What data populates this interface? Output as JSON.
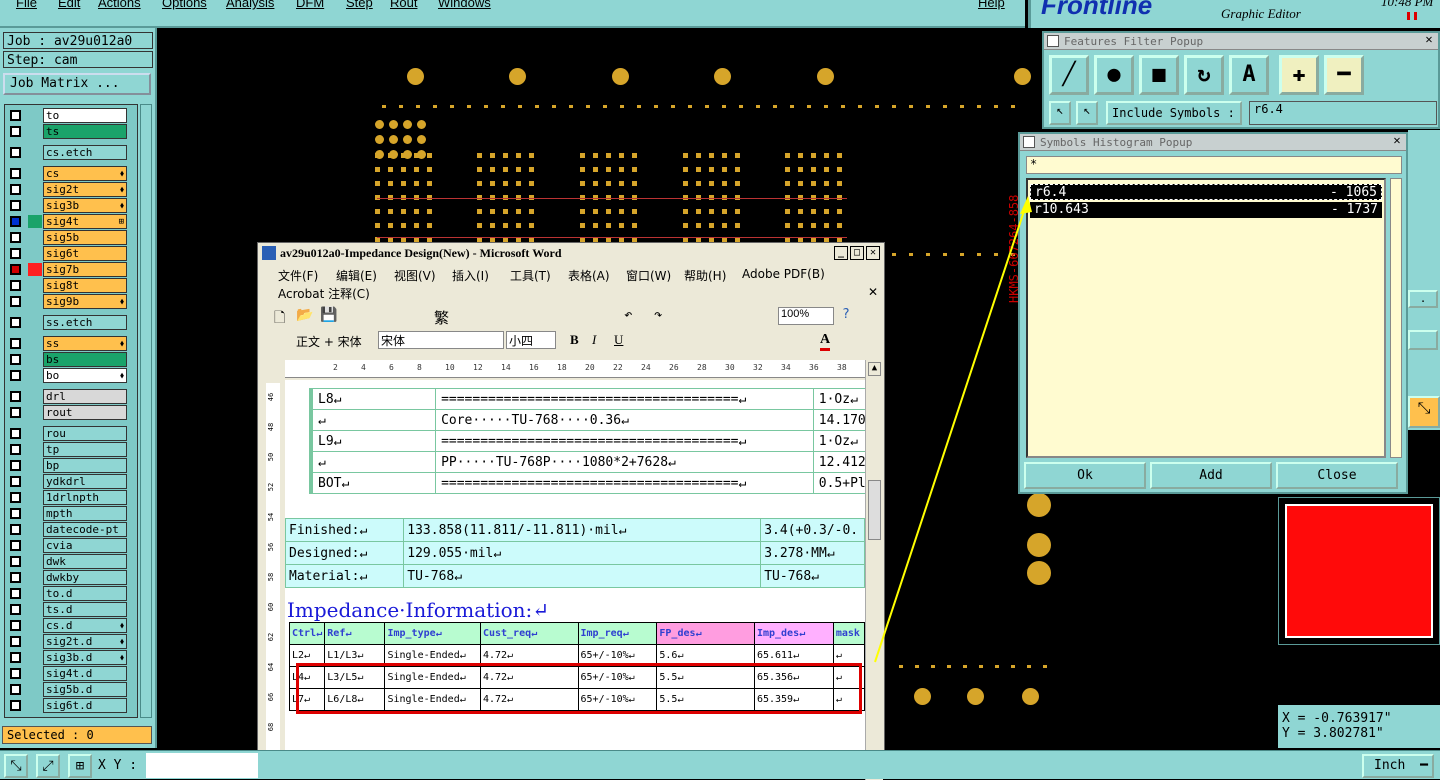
{
  "menu": {
    "items": [
      "File",
      "Edit",
      "Actions",
      "Options",
      "Analysis",
      "DFM",
      "Step",
      "Rout",
      "Windows"
    ],
    "help": "Help"
  },
  "brand": {
    "logo": "Frontline",
    "subtitle": "Graphic Editor",
    "time": "10:48 PM"
  },
  "job": {
    "job_label": "Job : av29u012a0",
    "step_label": "Step: cam",
    "matrix_button": "Job Matrix ..."
  },
  "layers": [
    {
      "name": "to",
      "color": "#ffffff",
      "flag": ""
    },
    {
      "name": "ts",
      "color": "#1aa36a",
      "flag": ""
    },
    {
      "name": "cs.etch",
      "color": "#8fd6d3",
      "flag": ""
    },
    {
      "name": "cs",
      "color": "#ffc04d",
      "flag": "⬧"
    },
    {
      "name": "sig2t",
      "color": "#ffc04d",
      "flag": "⬧"
    },
    {
      "name": "sig3b",
      "color": "#ffc04d",
      "flag": "⬧"
    },
    {
      "name": "sig4t",
      "color": "#ffc04d",
      "flag": "⊞"
    },
    {
      "name": "sig5b",
      "color": "#ffc04d",
      "flag": ""
    },
    {
      "name": "sig6t",
      "color": "#ffc04d",
      "flag": ""
    },
    {
      "name": "sig7b",
      "color": "#ffc04d",
      "flag": ""
    },
    {
      "name": "sig8t",
      "color": "#ffc04d",
      "flag": ""
    },
    {
      "name": "sig9b",
      "color": "#ffc04d",
      "flag": "⬧"
    },
    {
      "name": "ss.etch",
      "color": "#8fd6d3",
      "flag": ""
    },
    {
      "name": "ss",
      "color": "#ffc04d",
      "flag": "⬧"
    },
    {
      "name": "bs",
      "color": "#1aa36a",
      "flag": ""
    },
    {
      "name": "bo",
      "color": "#ffffff",
      "flag": "⬧"
    },
    {
      "name": "drl",
      "color": "#d8d8d8",
      "flag": ""
    },
    {
      "name": "rout",
      "color": "#d8d8d8",
      "flag": ""
    },
    {
      "name": "rou",
      "color": "#8fd6d3",
      "flag": ""
    },
    {
      "name": "tp",
      "color": "#8fd6d3",
      "flag": ""
    },
    {
      "name": "bp",
      "color": "#8fd6d3",
      "flag": ""
    },
    {
      "name": "ydkdrl",
      "color": "#8fd6d3",
      "flag": ""
    },
    {
      "name": "1drlnpth",
      "color": "#8fd6d3",
      "flag": ""
    },
    {
      "name": "mpth",
      "color": "#8fd6d3",
      "flag": ""
    },
    {
      "name": "datecode-pt",
      "color": "#8fd6d3",
      "flag": ""
    },
    {
      "name": "cvia",
      "color": "#8fd6d3",
      "flag": ""
    },
    {
      "name": "dwk",
      "color": "#8fd6d3",
      "flag": ""
    },
    {
      "name": "dwkby",
      "color": "#8fd6d3",
      "flag": ""
    },
    {
      "name": "to.d",
      "color": "#8fd6d3",
      "flag": ""
    },
    {
      "name": "ts.d",
      "color": "#8fd6d3",
      "flag": ""
    },
    {
      "name": "cs.d",
      "color": "#8fd6d3",
      "flag": "⬧"
    },
    {
      "name": "sig2t.d",
      "color": "#8fd6d3",
      "flag": "⬧"
    },
    {
      "name": "sig3b.d",
      "color": "#8fd6d3",
      "flag": "⬧"
    },
    {
      "name": "sig4t.d",
      "color": "#8fd6d3",
      "flag": ""
    },
    {
      "name": "sig5b.d",
      "color": "#8fd6d3",
      "flag": ""
    },
    {
      "name": "sig6t.d",
      "color": "#8fd6d3",
      "flag": ""
    }
  ],
  "selected": "Selected : 0",
  "bottom": {
    "xy_label": "X Y :",
    "units": "Inch"
  },
  "features_filter": {
    "title": "Features Filter Popup",
    "include_label": "Include Symbols :",
    "include_value": "r6.4"
  },
  "histogram": {
    "title": "Symbols Histogram Popup",
    "filter": "*",
    "rows": [
      {
        "symbol": "r6.4",
        "count": "- 1065"
      },
      {
        "symbol": "r10.643",
        "count": "- 1737"
      }
    ],
    "ok": "Ok",
    "add": "Add",
    "close": "Close"
  },
  "coords": {
    "x": "X = -0.763917\"",
    "y": "Y = 3.802781\""
  },
  "word": {
    "title": "av29u012a0-Impedance Design(New) - Microsoft Word",
    "menu": [
      "文件(F)",
      "编辑(E)",
      "视图(V)",
      "插入(I)",
      "工具(T)",
      "表格(A)",
      "窗口(W)",
      "帮助(H)",
      "Adobe PDF(B)"
    ],
    "menu2": "Acrobat 注释(C)",
    "zoom": "100%",
    "style": "正文 + 宋体",
    "font": "宋体",
    "size": "小四",
    "trad": "繁",
    "ruler": [
      "2",
      "4",
      "6",
      "8",
      "10",
      "12",
      "14",
      "16",
      "18",
      "20",
      "22",
      "24",
      "26",
      "28",
      "30",
      "32",
      "34",
      "36",
      "38"
    ],
    "vruler": [
      "46",
      "48",
      "50",
      "52",
      "54",
      "56",
      "58",
      "60",
      "62",
      "64",
      "66",
      "68"
    ],
    "stack": [
      [
        "L8↵",
        "======================================↵",
        "1·Oz↵"
      ],
      [
        "↵",
        "Core·····TU-768····0.36↵",
        "14.170"
      ],
      [
        "L9↵",
        "======================================↵",
        "1·Oz↵"
      ],
      [
        "↵",
        "PP·····TU-768P····1080*2+7628↵",
        "12.412"
      ],
      [
        "BOT↵",
        "======================================↵",
        "0.5+Pl"
      ]
    ],
    "materials": [
      [
        "Finished:↵",
        "133.858(11.811/-11.811)·mil↵",
        "3.4(+0.3/-0."
      ],
      [
        "Designed:↵",
        "129.055·mil↵",
        "3.278·MM↵"
      ],
      [
        "Material:↵",
        "TU-768↵",
        "TU-768↵"
      ]
    ],
    "imp_title": "Impedance·Information:↵",
    "imp_header": [
      "Ctrl↵",
      "Ref↵",
      "Imp_type↵",
      "Cust_req↵",
      "Imp_req↵",
      "FP_des↵",
      "Imp_des↵",
      "mask"
    ],
    "imp_rows": [
      [
        "L2↵",
        "L1/L3↵",
        "Single-Ended↵",
        "4.72↵",
        "65+/-10%↵",
        "5.6↵",
        "65.611↵",
        "↵"
      ],
      [
        "L4↵",
        "L3/L5↵",
        "Single-Ended↵",
        "4.72↵",
        "65+/-10%↵",
        "5.5↵",
        "65.356↵",
        "↵"
      ],
      [
        "L7↵",
        "L6/L8↵",
        "Single-Ended↵",
        "4.72↵",
        "65+/-10%↵",
        "5.5↵",
        "65.359↵",
        "↵"
      ]
    ]
  }
}
